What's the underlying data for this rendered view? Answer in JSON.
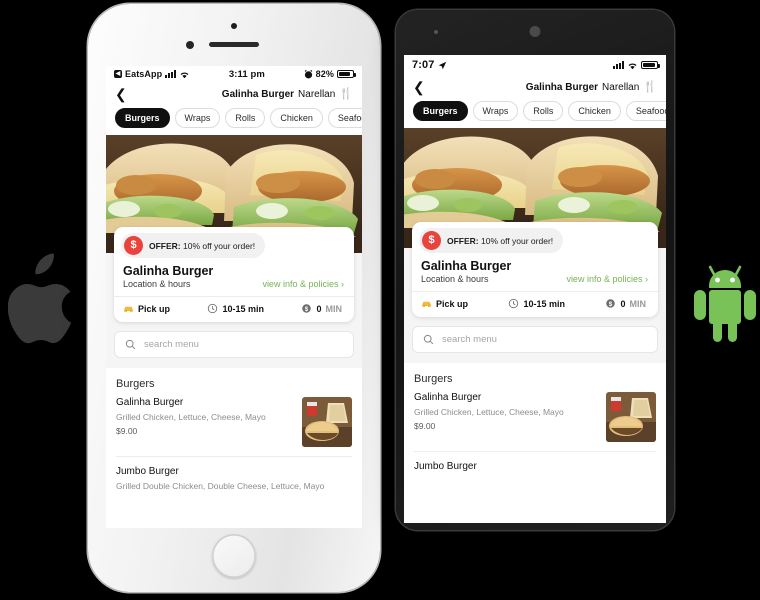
{
  "scene": {
    "background_color": "#000000",
    "apple_logo": {
      "name": "apple-logo",
      "color": "#3a3a3a"
    },
    "android_logo": {
      "name": "android-logo",
      "color": "#78c257"
    }
  },
  "ios": {
    "device": "iPhone",
    "frame_color": "#f2f2f2",
    "status_bar": {
      "carrier": "EatsApp",
      "carrier_badge": "◀",
      "time": "3:11 pm",
      "battery_percent": "82%",
      "alarm_icon": "alarm-icon",
      "signal_icon": "signal-bars-icon",
      "wifi_icon": "wifi-icon",
      "battery_icon": "battery-icon",
      "battery_level": 82
    },
    "nav": {
      "back_icon": "back-chevron-icon",
      "title_strong": "Galinha Burger",
      "title_rest": "Narellan",
      "cutlery_icon": "cutlery-icon"
    },
    "categories": [
      {
        "label": "Burgers",
        "active": true
      },
      {
        "label": "Wraps",
        "active": false
      },
      {
        "label": "Rolls",
        "active": false
      },
      {
        "label": "Chicken",
        "active": false
      },
      {
        "label": "Seafood",
        "active": false
      }
    ],
    "hero": {
      "name": "restaurant-hero-image",
      "alt": "Two chicken burgers with lettuce and cheese on wooden board"
    },
    "card": {
      "offer_badge": "$",
      "offer_label": "OFFER:",
      "offer_text": " 10% off your order!",
      "title": "Galinha Burger",
      "subtitle": "Location & hours",
      "link": "view info & policies",
      "link_chevron": "›",
      "link_color": "#77b255",
      "meta": [
        {
          "icon": "car-icon",
          "label": "Pick up",
          "muted": ""
        },
        {
          "icon": "clock-icon",
          "label": "10-15 min",
          "muted": ""
        },
        {
          "icon": "dollar-icon",
          "label": "0",
          "muted": "MIN"
        }
      ]
    },
    "search": {
      "icon": "search-icon",
      "placeholder": "search menu",
      "value": ""
    },
    "menu": {
      "section_title": "Burgers",
      "items": [
        {
          "name": "Galinha Burger",
          "desc": "Grilled Chicken, Lettuce, Cheese, Mayo",
          "price": "$9.00",
          "thumb": "burger-fries-thumbnail"
        },
        {
          "name": "Jumbo Burger",
          "desc": "Grilled Double Chicken, Double Cheese, Lettuce, Mayo",
          "price": "",
          "thumb": ""
        }
      ]
    }
  },
  "android": {
    "device": "Android",
    "frame_color": "#1a1a1a",
    "status_bar": {
      "time": "7:07",
      "location_icon": "location-arrow-icon",
      "signal_icon": "signal-bars-icon",
      "wifi_icon": "wifi-icon",
      "battery_icon": "battery-icon",
      "battery_level": 95
    },
    "nav": {
      "back_icon": "back-chevron-icon",
      "title_strong": "Galinha Burger",
      "title_rest": "Narellan",
      "cutlery_icon": "cutlery-icon"
    },
    "categories": [
      {
        "label": "Burgers",
        "active": true
      },
      {
        "label": "Wraps",
        "active": false
      },
      {
        "label": "Rolls",
        "active": false
      },
      {
        "label": "Chicken",
        "active": false
      },
      {
        "label": "Seafood",
        "active": false
      }
    ],
    "hero": {
      "name": "restaurant-hero-image",
      "alt": "Two chicken burgers with lettuce and cheese on wooden board"
    },
    "card": {
      "offer_badge": "$",
      "offer_label": "OFFER:",
      "offer_text": " 10% off your order!",
      "title": "Galinha Burger",
      "subtitle": "Location & hours",
      "link": "view info & policies",
      "link_chevron": "›",
      "link_color": "#77b255",
      "meta": [
        {
          "icon": "car-icon",
          "label": "Pick up",
          "muted": ""
        },
        {
          "icon": "clock-icon",
          "label": "10-15 min",
          "muted": ""
        },
        {
          "icon": "dollar-icon",
          "label": "0",
          "muted": "MIN"
        }
      ]
    },
    "search": {
      "icon": "search-icon",
      "placeholder": "search menu",
      "value": ""
    },
    "menu": {
      "section_title": "Burgers",
      "items": [
        {
          "name": "Galinha Burger",
          "desc": "Grilled Chicken, Lettuce, Cheese, Mayo",
          "price": "$9.00",
          "thumb": "burger-fries-thumbnail"
        },
        {
          "name": "Jumbo Burger",
          "desc": "",
          "price": "",
          "thumb": ""
        }
      ]
    }
  }
}
